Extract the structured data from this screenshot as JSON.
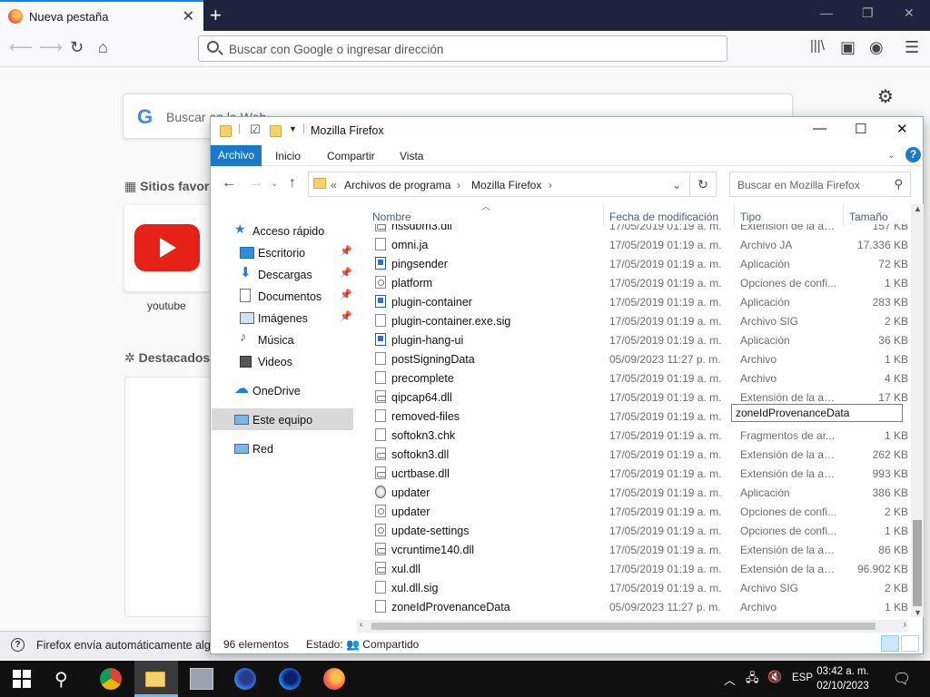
{
  "browser": {
    "tab_title": "Nueva pestaña",
    "new_tab_symbol": "+",
    "address_placeholder": "Buscar con Google o ingresar dirección",
    "newtab": {
      "search_placeholder": "Buscar en la Web",
      "topsites_heading": "Sitios favori",
      "topsite_label": "youtube",
      "highlights_heading": "Destacados",
      "notice_text": "Firefox envía automáticamente algu"
    }
  },
  "explorer": {
    "title": "Mozilla Firefox",
    "ribbon_tabs": [
      "Archivo",
      "Inicio",
      "Compartir",
      "Vista"
    ],
    "breadcrumb": {
      "overflow": "«",
      "items": [
        "Archivos de programa",
        "Mozilla Firefox"
      ]
    },
    "search_placeholder": "Buscar en Mozilla Firefox",
    "nav": {
      "quick_access": "Acceso rápido",
      "items": [
        "Escritorio",
        "Descargas",
        "Documentos",
        "Imágenes",
        "Música",
        "Videos"
      ],
      "onedrive": "OneDrive",
      "this_pc": "Este equipo",
      "network": "Red"
    },
    "columns": [
      "Nombre",
      "Fecha de modificación",
      "Tipo",
      "Tamaño"
    ],
    "partial_row": {
      "name": "nssdbm3.dll",
      "date": "17/05/2019 01:19 a. m.",
      "type": "Extensión de la ap...",
      "size": "157 KB"
    },
    "files": [
      {
        "name": "omni.ja",
        "date": "17/05/2019 01:19 a. m.",
        "type": "Archivo JA",
        "size": "17.336 KB",
        "icon": "file"
      },
      {
        "name": "pingsender",
        "date": "17/05/2019 01:19 a. m.",
        "type": "Aplicación",
        "size": "72 KB",
        "icon": "app"
      },
      {
        "name": "platform",
        "date": "17/05/2019 01:19 a. m.",
        "type": "Opciones de confi...",
        "size": "1 KB",
        "icon": "set"
      },
      {
        "name": "plugin-container",
        "date": "17/05/2019 01:19 a. m.",
        "type": "Aplicación",
        "size": "283 KB",
        "icon": "app"
      },
      {
        "name": "plugin-container.exe.sig",
        "date": "17/05/2019 01:19 a. m.",
        "type": "Archivo SIG",
        "size": "2 KB",
        "icon": "file"
      },
      {
        "name": "plugin-hang-ui",
        "date": "17/05/2019 01:19 a. m.",
        "type": "Aplicación",
        "size": "36 KB",
        "icon": "app"
      },
      {
        "name": "postSigningData",
        "date": "05/09/2023 11:27 p. m.",
        "type": "Archivo",
        "size": "1 KB",
        "icon": "file"
      },
      {
        "name": "precomplete",
        "date": "17/05/2019 01:19 a. m.",
        "type": "Archivo",
        "size": "4 KB",
        "icon": "file"
      },
      {
        "name": "qipcap64.dll",
        "date": "17/05/2019 01:19 a. m.",
        "type": "Extensión de la ap...",
        "size": "17 KB",
        "icon": "dll"
      },
      {
        "name": "removed-files",
        "date": "17/05/2019 01:19 a. m.",
        "type": "",
        "size": "",
        "icon": "file"
      },
      {
        "name": "softokn3.chk",
        "date": "17/05/2019 01:19 a. m.",
        "type": "Fragmentos de ar...",
        "size": "1 KB",
        "icon": "file"
      },
      {
        "name": "softokn3.dll",
        "date": "17/05/2019 01:19 a. m.",
        "type": "Extensión de la ap...",
        "size": "262 KB",
        "icon": "dll"
      },
      {
        "name": "ucrtbase.dll",
        "date": "17/05/2019 01:19 a. m.",
        "type": "Extensión de la ap...",
        "size": "993 KB",
        "icon": "dll"
      },
      {
        "name": "updater",
        "date": "17/05/2019 01:19 a. m.",
        "type": "Aplicación",
        "size": "386 KB",
        "icon": "glob"
      },
      {
        "name": "updater",
        "date": "17/05/2019 01:19 a. m.",
        "type": "Opciones de confi...",
        "size": "2 KB",
        "icon": "set"
      },
      {
        "name": "update-settings",
        "date": "17/05/2019 01:19 a. m.",
        "type": "Opciones de confi...",
        "size": "1 KB",
        "icon": "set"
      },
      {
        "name": "vcruntime140.dll",
        "date": "17/05/2019 01:19 a. m.",
        "type": "Extensión de la ap...",
        "size": "86 KB",
        "icon": "dll"
      },
      {
        "name": "xul.dll",
        "date": "17/05/2019 01:19 a. m.",
        "type": "Extensión de la ap...",
        "size": "96.902 KB",
        "icon": "dll"
      },
      {
        "name": "xul.dll.sig",
        "date": "17/05/2019 01:19 a. m.",
        "type": "Archivo SIG",
        "size": "2 KB",
        "icon": "file"
      },
      {
        "name": "zoneIdProvenanceData",
        "date": "05/09/2023 11:27 p. m.",
        "type": "Archivo",
        "size": "1 KB",
        "icon": "file"
      }
    ],
    "rename_tooltip": "zoneIdProvenanceData",
    "status_count": "96 elementos",
    "status_state": "Estado: 👥 Compartido"
  },
  "taskbar": {
    "language": "ESP",
    "time": "03:42 a. m.",
    "date": "02/10/2023"
  }
}
